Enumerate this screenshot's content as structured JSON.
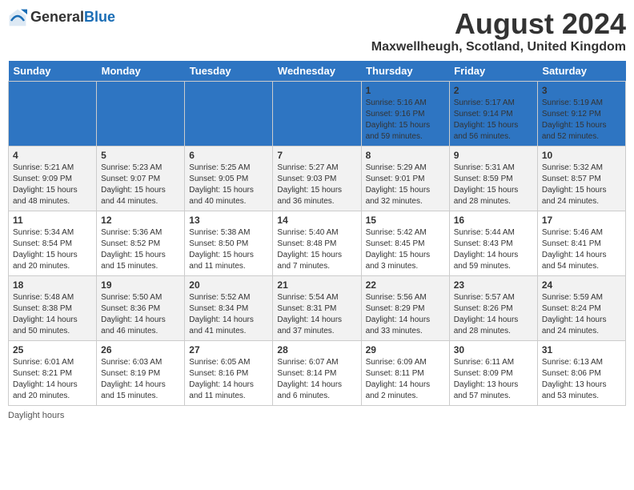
{
  "header": {
    "logo_general": "General",
    "logo_blue": "Blue",
    "title": "August 2024",
    "subtitle": "Maxwellheugh, Scotland, United Kingdom"
  },
  "days_of_week": [
    "Sunday",
    "Monday",
    "Tuesday",
    "Wednesday",
    "Thursday",
    "Friday",
    "Saturday"
  ],
  "weeks": [
    [
      {
        "day": "",
        "info": ""
      },
      {
        "day": "",
        "info": ""
      },
      {
        "day": "",
        "info": ""
      },
      {
        "day": "",
        "info": ""
      },
      {
        "day": "1",
        "info": "Sunrise: 5:16 AM\nSunset: 9:16 PM\nDaylight: 15 hours\nand 59 minutes."
      },
      {
        "day": "2",
        "info": "Sunrise: 5:17 AM\nSunset: 9:14 PM\nDaylight: 15 hours\nand 56 minutes."
      },
      {
        "day": "3",
        "info": "Sunrise: 5:19 AM\nSunset: 9:12 PM\nDaylight: 15 hours\nand 52 minutes."
      }
    ],
    [
      {
        "day": "4",
        "info": "Sunrise: 5:21 AM\nSunset: 9:09 PM\nDaylight: 15 hours\nand 48 minutes."
      },
      {
        "day": "5",
        "info": "Sunrise: 5:23 AM\nSunset: 9:07 PM\nDaylight: 15 hours\nand 44 minutes."
      },
      {
        "day": "6",
        "info": "Sunrise: 5:25 AM\nSunset: 9:05 PM\nDaylight: 15 hours\nand 40 minutes."
      },
      {
        "day": "7",
        "info": "Sunrise: 5:27 AM\nSunset: 9:03 PM\nDaylight: 15 hours\nand 36 minutes."
      },
      {
        "day": "8",
        "info": "Sunrise: 5:29 AM\nSunset: 9:01 PM\nDaylight: 15 hours\nand 32 minutes."
      },
      {
        "day": "9",
        "info": "Sunrise: 5:31 AM\nSunset: 8:59 PM\nDaylight: 15 hours\nand 28 minutes."
      },
      {
        "day": "10",
        "info": "Sunrise: 5:32 AM\nSunset: 8:57 PM\nDaylight: 15 hours\nand 24 minutes."
      }
    ],
    [
      {
        "day": "11",
        "info": "Sunrise: 5:34 AM\nSunset: 8:54 PM\nDaylight: 15 hours\nand 20 minutes."
      },
      {
        "day": "12",
        "info": "Sunrise: 5:36 AM\nSunset: 8:52 PM\nDaylight: 15 hours\nand 15 minutes."
      },
      {
        "day": "13",
        "info": "Sunrise: 5:38 AM\nSunset: 8:50 PM\nDaylight: 15 hours\nand 11 minutes."
      },
      {
        "day": "14",
        "info": "Sunrise: 5:40 AM\nSunset: 8:48 PM\nDaylight: 15 hours\nand 7 minutes."
      },
      {
        "day": "15",
        "info": "Sunrise: 5:42 AM\nSunset: 8:45 PM\nDaylight: 15 hours\nand 3 minutes."
      },
      {
        "day": "16",
        "info": "Sunrise: 5:44 AM\nSunset: 8:43 PM\nDaylight: 14 hours\nand 59 minutes."
      },
      {
        "day": "17",
        "info": "Sunrise: 5:46 AM\nSunset: 8:41 PM\nDaylight: 14 hours\nand 54 minutes."
      }
    ],
    [
      {
        "day": "18",
        "info": "Sunrise: 5:48 AM\nSunset: 8:38 PM\nDaylight: 14 hours\nand 50 minutes."
      },
      {
        "day": "19",
        "info": "Sunrise: 5:50 AM\nSunset: 8:36 PM\nDaylight: 14 hours\nand 46 minutes."
      },
      {
        "day": "20",
        "info": "Sunrise: 5:52 AM\nSunset: 8:34 PM\nDaylight: 14 hours\nand 41 minutes."
      },
      {
        "day": "21",
        "info": "Sunrise: 5:54 AM\nSunset: 8:31 PM\nDaylight: 14 hours\nand 37 minutes."
      },
      {
        "day": "22",
        "info": "Sunrise: 5:56 AM\nSunset: 8:29 PM\nDaylight: 14 hours\nand 33 minutes."
      },
      {
        "day": "23",
        "info": "Sunrise: 5:57 AM\nSunset: 8:26 PM\nDaylight: 14 hours\nand 28 minutes."
      },
      {
        "day": "24",
        "info": "Sunrise: 5:59 AM\nSunset: 8:24 PM\nDaylight: 14 hours\nand 24 minutes."
      }
    ],
    [
      {
        "day": "25",
        "info": "Sunrise: 6:01 AM\nSunset: 8:21 PM\nDaylight: 14 hours\nand 20 minutes."
      },
      {
        "day": "26",
        "info": "Sunrise: 6:03 AM\nSunset: 8:19 PM\nDaylight: 14 hours\nand 15 minutes."
      },
      {
        "day": "27",
        "info": "Sunrise: 6:05 AM\nSunset: 8:16 PM\nDaylight: 14 hours\nand 11 minutes."
      },
      {
        "day": "28",
        "info": "Sunrise: 6:07 AM\nSunset: 8:14 PM\nDaylight: 14 hours\nand 6 minutes."
      },
      {
        "day": "29",
        "info": "Sunrise: 6:09 AM\nSunset: 8:11 PM\nDaylight: 14 hours\nand 2 minutes."
      },
      {
        "day": "30",
        "info": "Sunrise: 6:11 AM\nSunset: 8:09 PM\nDaylight: 13 hours\nand 57 minutes."
      },
      {
        "day": "31",
        "info": "Sunrise: 6:13 AM\nSunset: 8:06 PM\nDaylight: 13 hours\nand 53 minutes."
      }
    ]
  ],
  "footer": {
    "daylight_label": "Daylight hours"
  }
}
